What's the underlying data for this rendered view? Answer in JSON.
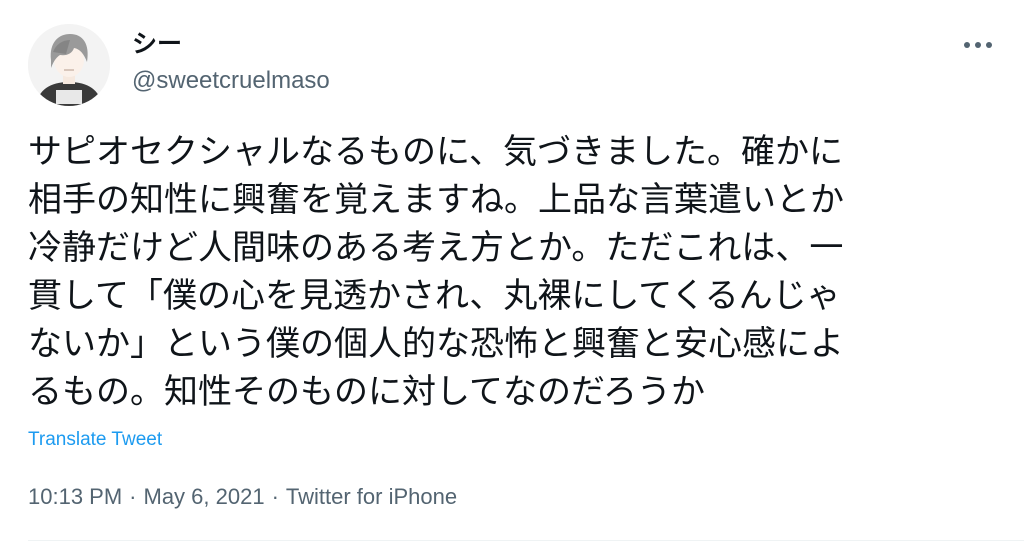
{
  "author": {
    "display_name": "シー",
    "handle": "@sweetcruelmaso",
    "avatar_icon": "anime-avatar-icon"
  },
  "tweet": {
    "lines": [
      "サピオセクシャルなるものに、気づきました。確かに",
      "相手の知性に興奮を覚えますね。上品な言葉遣いとか",
      "冷静だけど人間味のある考え方とか。ただこれは、一",
      "貫して「僕の心を見透かされ、丸裸にしてくるんじゃ",
      "ないか」という僕の個人的な恐怖と興奮と安心感によ",
      "るもの。知性そのものに対してなのだろうか"
    ],
    "translate_label": "Translate Tweet",
    "time": "10:13 PM",
    "date": "May 6, 2021",
    "source": "Twitter for iPhone",
    "separator": "·"
  },
  "icons": {
    "more": "more-horizontal-icon"
  },
  "colors": {
    "text_primary": "#0f1419",
    "text_secondary": "#536471",
    "link": "#1d9bf0",
    "divider": "#eff3f4"
  }
}
